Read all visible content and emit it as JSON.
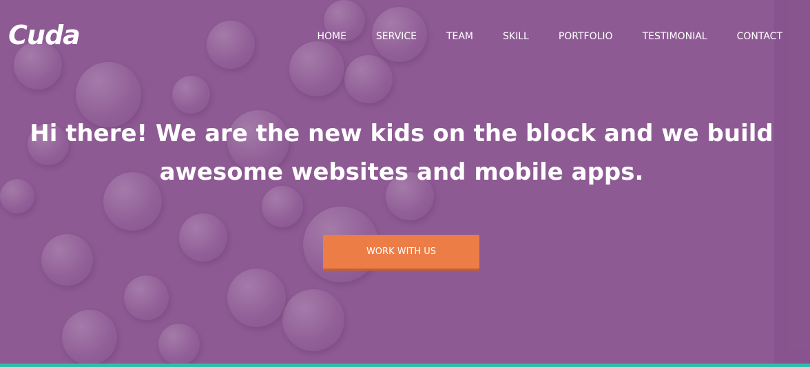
{
  "brand": {
    "logo_text": "Cuda"
  },
  "nav": {
    "items": [
      {
        "label": "HOME"
      },
      {
        "label": "SERVICE"
      },
      {
        "label": "TEAM"
      },
      {
        "label": "SKILL"
      },
      {
        "label": "PORTFOLIO"
      },
      {
        "label": "TESTIMONIAL"
      },
      {
        "label": "CONTACT"
      }
    ]
  },
  "hero": {
    "headline_line1": "Hi there! We are the new kids on the block and we build",
    "headline_line2": "awesome websites and mobile apps.",
    "cta_label": "WORK WITH US"
  },
  "colors": {
    "background": "#8e5a94",
    "cta": "#ec7d47",
    "cta_shadow": "#c75f2c",
    "bottom_strip": "#2ebfab",
    "text": "#ffffff"
  }
}
